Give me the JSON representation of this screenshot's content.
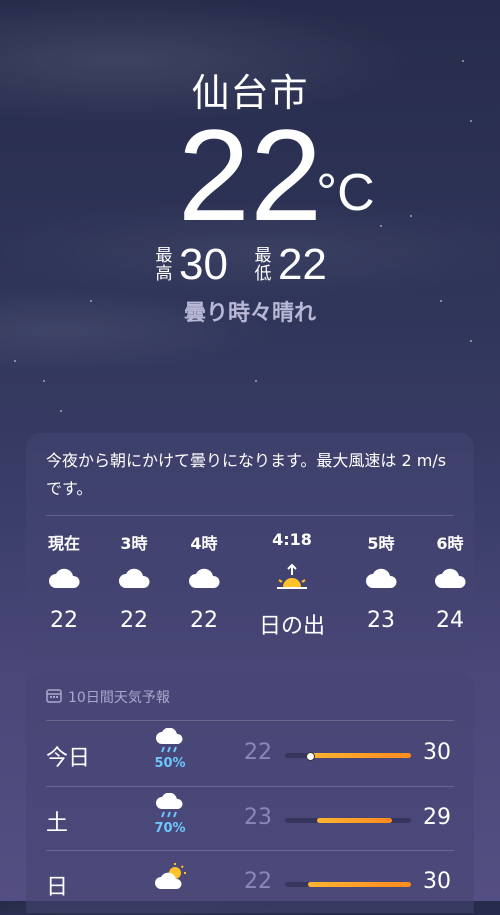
{
  "location": {
    "city": "仙台市"
  },
  "current": {
    "temperature": "22",
    "unit": "°C",
    "high_label": [
      "最",
      "高"
    ],
    "high": "30",
    "low_label": [
      "最",
      "低"
    ],
    "low": "22",
    "condition": "曇り時々晴れ"
  },
  "hourly": {
    "summary": "今夜から朝にかけて曇りになります。最大風速は 2 m/s です。",
    "items": [
      {
        "time": "現在",
        "icon": "cloud-icon",
        "value": "22"
      },
      {
        "time": "3時",
        "icon": "cloud-icon",
        "value": "22"
      },
      {
        "time": "4時",
        "icon": "cloud-icon",
        "value": "22"
      },
      {
        "time": "4:18",
        "icon": "sunrise-icon",
        "value": "日の出"
      },
      {
        "time": "5時",
        "icon": "cloud-icon",
        "value": "23"
      },
      {
        "time": "6時",
        "icon": "cloud-icon",
        "value": "24"
      }
    ]
  },
  "forecast": {
    "title": "10日間天気予報",
    "icon": "calendar-icon",
    "days": [
      {
        "day": "今日",
        "icon": "cloud-rain-icon",
        "precip": "50%",
        "low": "22",
        "high": "30",
        "bar_start": 0.18,
        "bar_end": 1.0,
        "current_marker": 0.2
      },
      {
        "day": "土",
        "icon": "cloud-rain-icon",
        "precip": "70%",
        "low": "23",
        "high": "29",
        "bar_start": 0.25,
        "bar_end": 0.85
      },
      {
        "day": "日",
        "icon": "partly-cloudy-icon",
        "precip": "",
        "low": "22",
        "high": "30",
        "bar_start": 0.18,
        "bar_end": 1.0
      }
    ]
  },
  "colors": {
    "accent_orange": "#ff9a22",
    "precip_blue": "#6ec6ff",
    "card_bg": "#464673"
  }
}
